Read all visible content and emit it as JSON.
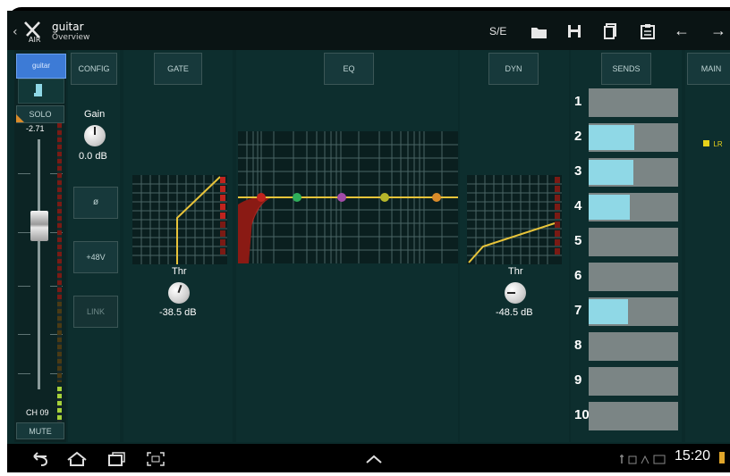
{
  "header": {
    "title": "guitar",
    "subtitle": "Overview",
    "logo_letters": "X AIR",
    "se_label": "S/E"
  },
  "channel": {
    "name_button": "guitar",
    "solo": "SOLO",
    "level": "-2.71",
    "label": "CH 09",
    "mute": "MUTE"
  },
  "config": {
    "button": "CONFIG",
    "gain_label": "Gain",
    "gain_value": "0.0 dB",
    "phase_button": "ø",
    "phantom_button": "+48V",
    "link_button": "LINK"
  },
  "gate": {
    "button": "GATE",
    "thr_label": "Thr",
    "thr_value": "-38.5 dB"
  },
  "eq": {
    "button": "EQ"
  },
  "dyn": {
    "button": "DYN",
    "thr_label": "Thr",
    "thr_value": "-48.5 dB"
  },
  "sends": {
    "button": "SENDS",
    "rows": [
      {
        "num": "1",
        "level": 0
      },
      {
        "num": "2",
        "level": 0.51
      },
      {
        "num": "3",
        "level": 0.5
      },
      {
        "num": "4",
        "level": 0.46
      },
      {
        "num": "5",
        "level": 0
      },
      {
        "num": "6",
        "level": 0
      },
      {
        "num": "7",
        "level": 0.44
      },
      {
        "num": "8",
        "level": 0
      },
      {
        "num": "9",
        "level": 0
      },
      {
        "num": "10",
        "level": 0
      }
    ]
  },
  "main": {
    "button": "MAIN",
    "lr_label": "LR"
  },
  "statusbar": {
    "time": "15:20"
  },
  "colors": {
    "accent_blue": "#3d7bd6",
    "send_fill": "#8fd8e6",
    "curve_yellow": "#e8c43a",
    "gate_red": "#c0241e"
  }
}
